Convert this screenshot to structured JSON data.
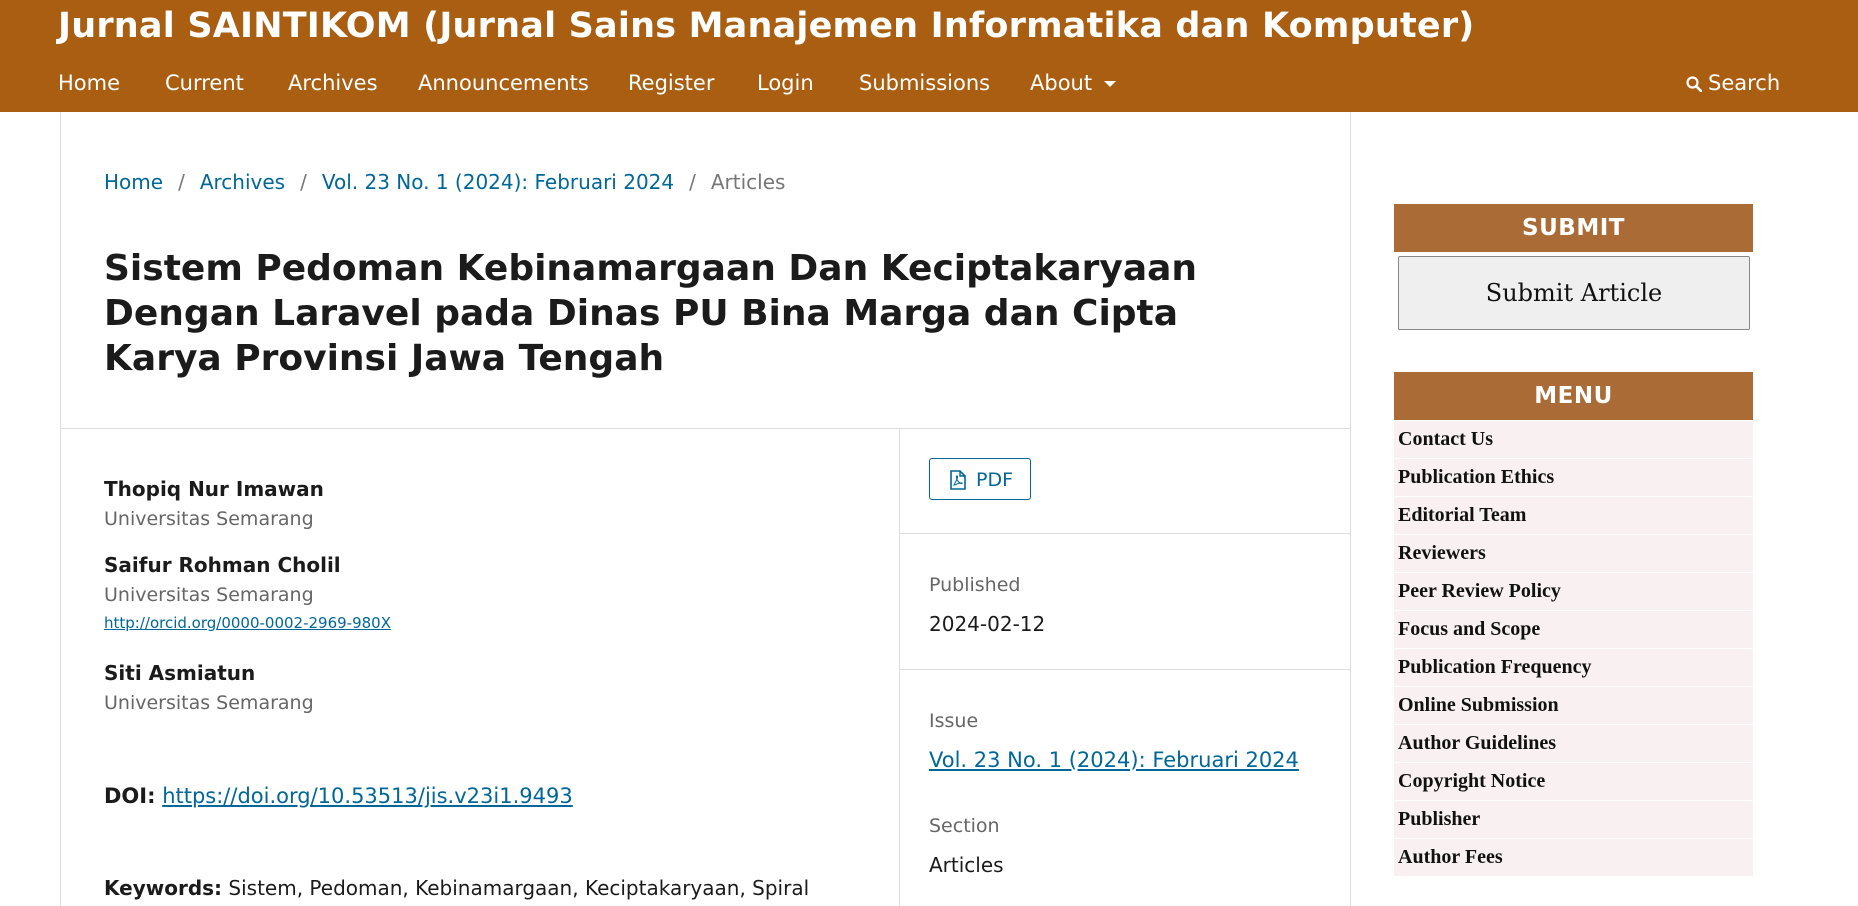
{
  "header": {
    "site_title": "Jurnal SAINTIKOM (Jurnal Sains Manajemen Informatika dan Komputer)",
    "nav": [
      "Home",
      "Current",
      "Archives",
      "Announcements",
      "Register",
      "Login",
      "Submissions",
      "About"
    ],
    "search_label": "Search"
  },
  "breadcrumb": {
    "home": "Home",
    "archives": "Archives",
    "issue": "Vol. 23 No. 1 (2024): Februari 2024",
    "current": "Articles",
    "separator": "/"
  },
  "article": {
    "title": "Sistem Pedoman Kebinamargaan Dan Keciptakaryaan Dengan Laravel pada Dinas PU Bina Marga dan Cipta Karya Provinsi Jawa Tengah",
    "authors": [
      {
        "name": "Thopiq Nur Imawan",
        "affiliation": "Universitas Semarang"
      },
      {
        "name": "Saifur Rohman Cholil",
        "affiliation": "Universitas Semarang",
        "orcid": "http://orcid.org/0000-0002-2969-980X"
      },
      {
        "name": "Siti Asmiatun",
        "affiliation": "Universitas Semarang"
      }
    ],
    "doi_label": "DOI:",
    "doi_url": "https://doi.org/10.53513/jis.v23i1.9493",
    "keywords_label": "Keywords:",
    "keywords": "Sistem, Pedoman, Kebinamargaan, Keciptakaryaan, Spiral"
  },
  "details": {
    "pdf_label": "PDF",
    "published_label": "Published",
    "published_value": "2024-02-12",
    "issue_label": "Issue",
    "issue_value": "Vol. 23 No. 1 (2024): Februari 2024",
    "section_label": "Section",
    "section_value": "Articles"
  },
  "sidebar": {
    "submit_heading": "SUBMIT",
    "submit_button": "Submit Article",
    "menu_heading": "MENU",
    "menu_items": [
      "Contact Us",
      "Publication Ethics",
      "Editorial Team",
      "Reviewers",
      "Peer Review Policy",
      "Focus and Scope",
      "Publication Frequency",
      "Online Submission",
      "Author Guidelines",
      "Copyright Notice",
      "Publisher",
      "Author Fees"
    ]
  },
  "colors": {
    "header_bg": "#a95e12",
    "sidebar_heading_bg": "#aa6b36",
    "link": "#006798",
    "menu_item_bg": "#f9f1f1"
  },
  "icons": [
    "search-icon",
    "pdf-file-icon",
    "chevron-down-icon"
  ]
}
